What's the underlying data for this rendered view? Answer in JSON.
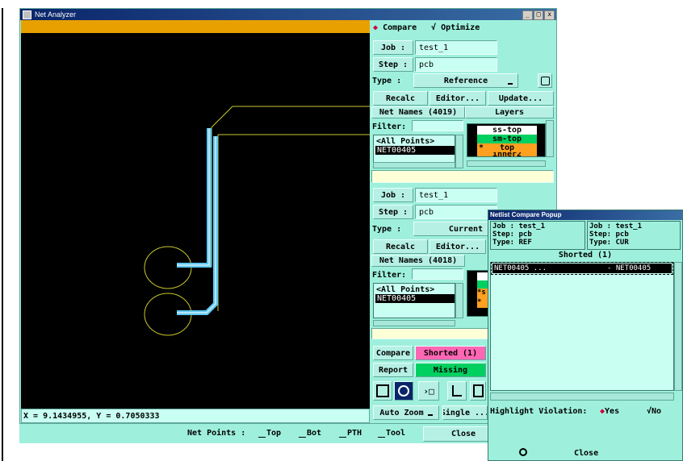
{
  "main_window": {
    "title": "Net Analyzer",
    "controls": [
      "_",
      "□",
      "x"
    ],
    "coords": "X = 9.1434955, Y = 0.7050333"
  },
  "panel": {
    "mode_compare": "Compare",
    "mode_optimize": "Optimize",
    "ref": {
      "job_label": "Job :",
      "job_value": "test_1",
      "step_label": "Step :",
      "step_value": "pcb",
      "type_label": "Type :",
      "type_value": "Reference",
      "recalc": "Recalc",
      "editor": "Editor...",
      "update": "Update...",
      "net_names": "Net Names (4019)",
      "layers": "Layers",
      "filter_label": "Filter:",
      "nets": [
        "<All Points>",
        "NET00405"
      ],
      "layer_items": [
        {
          "mark": "",
          "name": "ss-top"
        },
        {
          "mark": "",
          "name": "sm-top"
        },
        {
          "mark": "*",
          "name": "top"
        },
        {
          "mark": "",
          "name": "inner2"
        }
      ]
    },
    "cur": {
      "job_label": "Job :",
      "job_value": "test_1",
      "step_label": "Step :",
      "step_value": "pcb",
      "type_label": "Type :",
      "type_value": "Current",
      "recalc": "Recalc",
      "editor": "Editor...",
      "net_names": "Net Names (4018)",
      "filter_label": "Filter:",
      "nets": [
        "<All Points>",
        "NET00405"
      ],
      "layer_marks": [
        "",
        "",
        "*s",
        "*"
      ]
    },
    "compare_btn": "Compare",
    "shorted_btn": "Shorted (1)",
    "report_btn": "Report",
    "missing_btn": "Missing",
    "auto_zoom": "Auto Zoom",
    "single": "Single ..."
  },
  "bottom_bar": {
    "net_points_label": "Net Points :",
    "toggles": [
      "Top",
      "Bot",
      "PTH",
      "Tool"
    ],
    "close": "Close"
  },
  "popup": {
    "title": "Netlist Compare Popup",
    "left_job": "Job : test_1",
    "left_step": "Step: pcb",
    "left_type": "Type: REF",
    "right_job": "Job : test_1",
    "right_step": "Step: pcb",
    "right_type": "Type: CUR",
    "section": "Shorted (1)",
    "row_left": "NET00405 ...",
    "row_right": "- NET00405",
    "highlight_label": "Highlight Violation:",
    "yes": "Yes",
    "no": "No",
    "close": "Close"
  },
  "colors": {
    "panel_bg": "#9ef0dc",
    "canvas_bg": "#000000",
    "orange_bar": "#e8a000",
    "title_bar": "#0a246a",
    "trace": "#5ec8f0",
    "outline": "#c8c832",
    "shorted": "#ff66b4",
    "missing": "#00d060",
    "layer_green": "#00d060",
    "layer_orange": "#ffa020"
  }
}
